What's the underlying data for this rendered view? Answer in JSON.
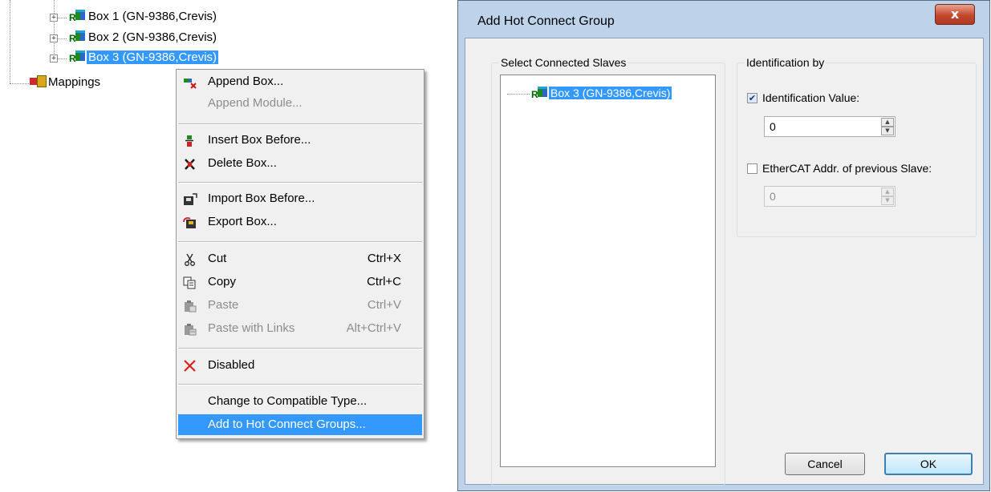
{
  "tree": {
    "items": [
      {
        "label": "Box 1 (GN-9386,Crevis)",
        "selected": false
      },
      {
        "label": "Box 2 (GN-9386,Crevis)",
        "selected": false
      },
      {
        "label": "Box 3 (GN-9386,Crevis)",
        "selected": true
      }
    ],
    "mappings_label": "Mappings",
    "expander_glyph": "+"
  },
  "context_menu": {
    "append_box": "Append Box...",
    "append_module": "Append Module...",
    "insert_box_before": "Insert Box Before...",
    "delete_box": "Delete Box...",
    "import_box_before": "Import Box Before...",
    "export_box": "Export Box...",
    "cut": "Cut",
    "cut_shortcut": "Ctrl+X",
    "copy": "Copy",
    "copy_shortcut": "Ctrl+C",
    "paste": "Paste",
    "paste_shortcut": "Ctrl+V",
    "paste_with_links": "Paste with Links",
    "paste_with_links_shortcut": "Alt+Ctrl+V",
    "disabled": "Disabled",
    "change_to_compatible_type": "Change to Compatible Type...",
    "add_to_hot_connect_groups": "Add to Hot Connect Groups..."
  },
  "dialog": {
    "title": "Add Hot Connect Group",
    "close_glyph": "x",
    "select_connected_slaves_label": "Select Connected Slaves",
    "slave_item": "Box 3 (GN-9386,Crevis)",
    "identification_by_label": "Identification by",
    "identification_value_label": "Identification Value:",
    "identification_value_checked": true,
    "identification_value": "0",
    "ethercat_addr_label": "EtherCAT Addr. of previous Slave:",
    "ethercat_addr_checked": false,
    "ethercat_addr_value": "0",
    "check_glyph": "✔",
    "cancel_label": "Cancel",
    "ok_label": "OK"
  },
  "colors": {
    "selection": "#3399ff",
    "menu_background": "#f0f0f0",
    "dialog_frame": "#bcd3ea",
    "close_button": "#c2482e"
  }
}
